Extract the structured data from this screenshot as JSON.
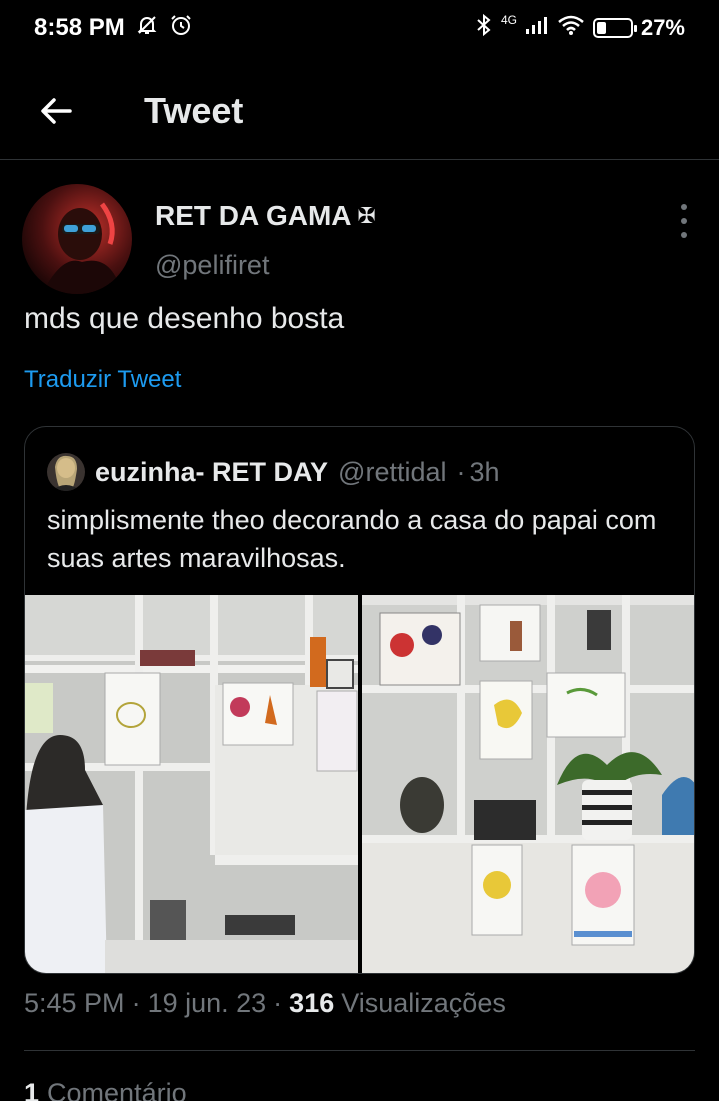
{
  "status_bar": {
    "time": "8:58 PM",
    "network": "4G",
    "battery_percent": "27%",
    "battery_level": 0.27,
    "icons": [
      "mute-icon",
      "alarm-icon",
      "bluetooth-icon",
      "signal-icon",
      "wifi-icon",
      "battery-icon"
    ]
  },
  "header": {
    "title": "Tweet",
    "back_icon": "arrow-left-icon"
  },
  "tweet": {
    "author_name": "RET DA GAMA",
    "author_badge": "✠",
    "author_handle": "@pelifiret",
    "text": "mds que desenho bosta",
    "translate_label": "Traduzir Tweet",
    "time": "5:45 PM",
    "date": "19 jun. 23",
    "views_count": "316",
    "views_label": "Visualizações",
    "sep": "·"
  },
  "quote": {
    "author_name": "euzinha- RET DAY",
    "author_handle": "@rettidal",
    "time_ago": "3h",
    "sep": "·",
    "text": "simplismente theo decorando a casa do papai com suas artes maravilhosas."
  },
  "footer": {
    "comment_count": "1",
    "comment_label": "Comentário"
  },
  "colors": {
    "background": "#000000",
    "text": "#e7e9ea",
    "muted": "#71767b",
    "link": "#1d9bf0",
    "border": "#2f3336"
  }
}
